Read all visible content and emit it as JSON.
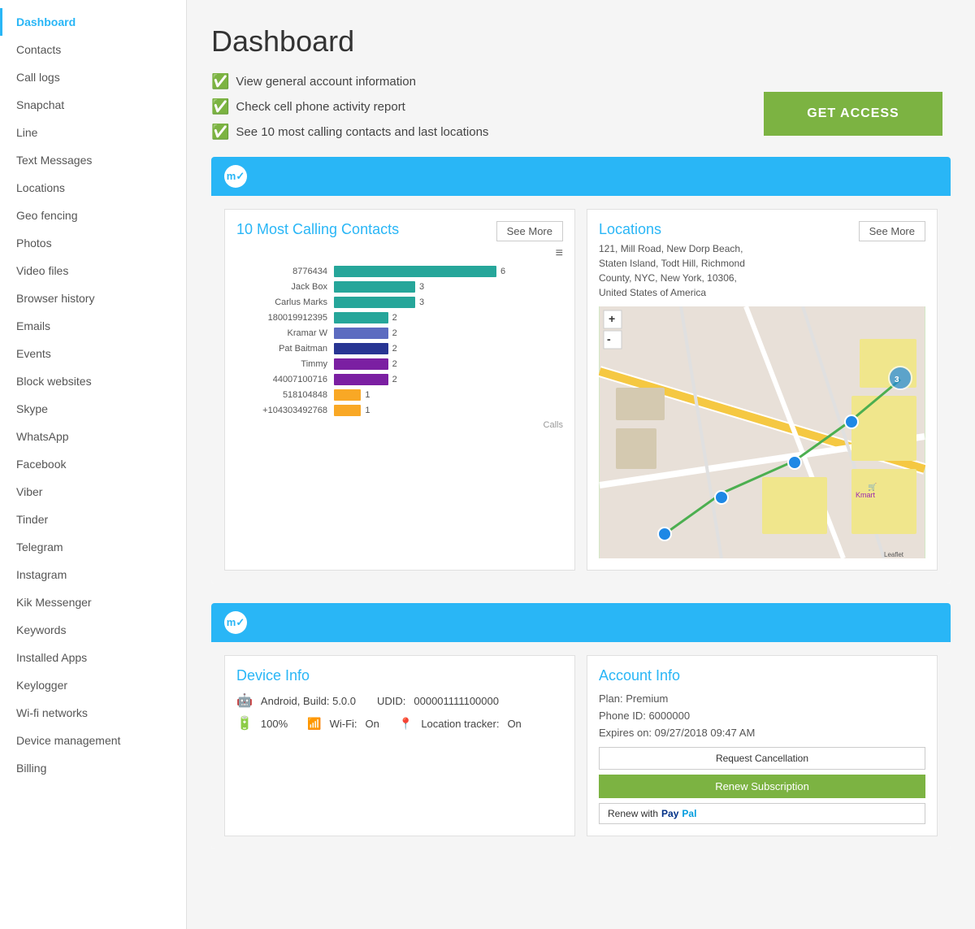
{
  "sidebar": {
    "items": [
      {
        "label": "Dashboard",
        "active": true
      },
      {
        "label": "Contacts",
        "active": false
      },
      {
        "label": "Call logs",
        "active": false
      },
      {
        "label": "Snapchat",
        "active": false
      },
      {
        "label": "Line",
        "active": false
      },
      {
        "label": "Text Messages",
        "active": false
      },
      {
        "label": "Locations",
        "active": false
      },
      {
        "label": "Geo fencing",
        "active": false
      },
      {
        "label": "Photos",
        "active": false
      },
      {
        "label": "Video files",
        "active": false
      },
      {
        "label": "Browser history",
        "active": false
      },
      {
        "label": "Emails",
        "active": false
      },
      {
        "label": "Events",
        "active": false
      },
      {
        "label": "Block websites",
        "active": false
      },
      {
        "label": "Skype",
        "active": false
      },
      {
        "label": "WhatsApp",
        "active": false
      },
      {
        "label": "Facebook",
        "active": false
      },
      {
        "label": "Viber",
        "active": false
      },
      {
        "label": "Tinder",
        "active": false
      },
      {
        "label": "Telegram",
        "active": false
      },
      {
        "label": "Instagram",
        "active": false
      },
      {
        "label": "Kik Messenger",
        "active": false
      },
      {
        "label": "Keywords",
        "active": false
      },
      {
        "label": "Installed Apps",
        "active": false
      },
      {
        "label": "Keylogger",
        "active": false
      },
      {
        "label": "Wi-fi networks",
        "active": false
      },
      {
        "label": "Device management",
        "active": false
      },
      {
        "label": "Billing",
        "active": false
      }
    ]
  },
  "page": {
    "title": "Dashboard",
    "checklist": [
      "View general account information",
      "Check cell phone activity report",
      "See 10 most calling contacts and last locations"
    ],
    "get_access_label": "GET ACCESS"
  },
  "contacts_card": {
    "title": "10 Most Calling Contacts",
    "see_more_label": "See More",
    "hamburger": "≡",
    "x_axis_label": "Calls",
    "bars": [
      {
        "label": "8776434",
        "value": 6,
        "color": "#26a69a",
        "max": 6
      },
      {
        "label": "Jack Box",
        "value": 3,
        "color": "#26a69a",
        "max": 6
      },
      {
        "label": "Carlus Marks",
        "value": 3,
        "color": "#26a69a",
        "max": 6
      },
      {
        "label": "180019912395",
        "value": 2,
        "color": "#26a69a",
        "max": 6
      },
      {
        "label": "Kramar W",
        "value": 2,
        "color": "#5c6bc0",
        "max": 6
      },
      {
        "label": "Pat Baitman",
        "value": 2,
        "color": "#283593",
        "max": 6
      },
      {
        "label": "Timmy",
        "value": 2,
        "color": "#7b1fa2",
        "max": 6
      },
      {
        "label": "44007100716",
        "value": 2,
        "color": "#7b1fa2",
        "max": 6
      },
      {
        "label": "518104848",
        "value": 1,
        "color": "#f9a825",
        "max": 6
      },
      {
        "label": "+104303492768",
        "value": 1,
        "color": "#f9a825",
        "max": 6
      }
    ]
  },
  "locations_card": {
    "title": "Locations",
    "address": "121, Mill Road, New Dorp Beach,\nStaten Island, Todt Hill, Richmond\nCounty, NYC, New York, 10306,\nUnited States of America",
    "see_more_label": "See More",
    "zoom_in": "+",
    "zoom_out": "-",
    "leaflet_label": "Leaflet"
  },
  "device_info": {
    "title": "Device Info",
    "os": "Android, Build: 5.0.0",
    "udid_label": "UDID:",
    "udid": "000001111100000",
    "battery_label": "100%",
    "wifi_label": "Wi-Fi:",
    "wifi_status": "On",
    "location_tracker_label": "Location tracker:",
    "location_tracker_status": "On"
  },
  "account_info": {
    "title": "Account Info",
    "plan_label": "Plan:",
    "plan": "Premium",
    "phone_id_label": "Phone ID:",
    "phone_id": "6000000",
    "expires_label": "Expires on:",
    "expires": "09/27/2018 09:47 AM",
    "request_cancellation_label": "Request Cancellation",
    "renew_subscription_label": "Renew Subscription",
    "renew_paypal_label": "Renew with PayPal"
  }
}
